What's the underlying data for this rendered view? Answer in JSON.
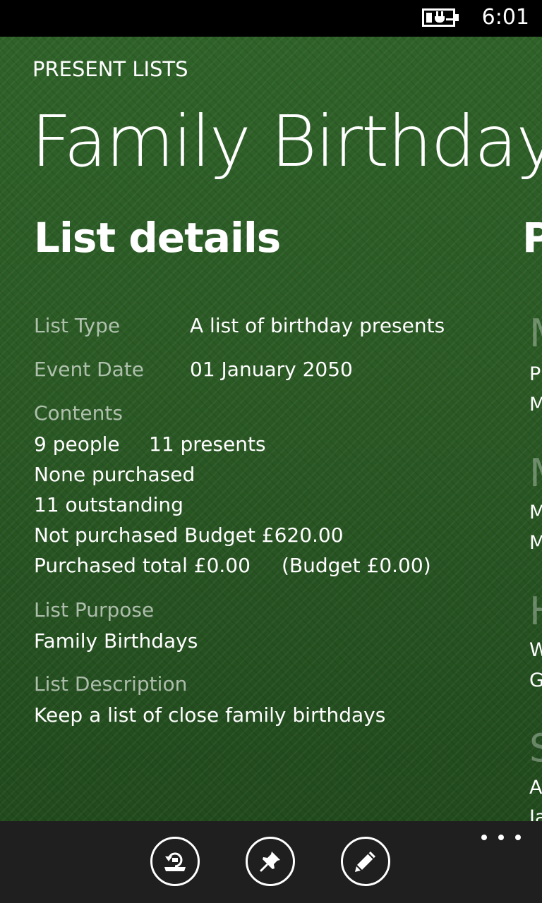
{
  "status_bar": {
    "time": "6:01",
    "battery_icon": "battery-charging-icon"
  },
  "header": {
    "app_title": "PRESENT LISTS",
    "pivot_title": "Family Birthdays"
  },
  "section": {
    "title": "List details",
    "next_section_peek": "P"
  },
  "details": {
    "list_type_label": "List Type",
    "list_type_value": "A list of birthday presents",
    "event_date_label": "Event Date",
    "event_date_value": "01 January 2050",
    "contents_label": "Contents",
    "people": "9 people",
    "presents": "11 presents",
    "purchased_status": "None purchased",
    "outstanding": "11 outstanding",
    "not_purchased_budget": "Not purchased Budget £620.00",
    "purchased_total": "Purchased total £0.00",
    "purchased_budget": "(Budget £0.00)",
    "purpose_label": "List Purpose",
    "purpose_value": "Family Birthdays",
    "description_label": "List Description",
    "description_value": "Keep a list of close family birthdays"
  },
  "peek": {
    "big": [
      "M",
      "M",
      "H",
      "S"
    ],
    "small": [
      "P",
      "M",
      "M",
      "M",
      "W",
      "G",
      "A",
      "Ja"
    ]
  },
  "app_bar": {
    "buttons": [
      {
        "icon": "restore-icon"
      },
      {
        "icon": "pin-icon"
      },
      {
        "icon": "edit-icon"
      }
    ],
    "more_icon": "more-ellipsis-icon"
  }
}
